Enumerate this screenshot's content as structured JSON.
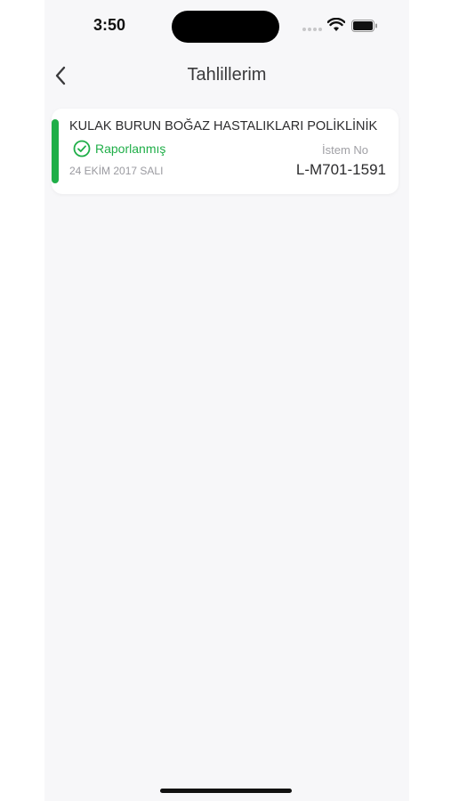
{
  "status_bar": {
    "time": "3:50",
    "icons": [
      "signal-dots-icon",
      "wifi-icon",
      "battery-icon"
    ]
  },
  "nav": {
    "title": "Tahlillerim",
    "back_icon": "chevron-left-icon"
  },
  "records": [
    {
      "clinic": "KULAK BURUN BOĞAZ HASTALIKLARI POLİKLİNİK",
      "status": "Raporlanmış",
      "status_icon": "check-circle-icon",
      "date": "24 EKİM 2017 SALI",
      "istem_label": "İstem No",
      "istem_no": "L-M701-1591"
    }
  ],
  "colors": {
    "accent_green": "#1fae48",
    "background": "#f7f7f9",
    "card": "#ffffff",
    "text_primary": "#2c2c2e",
    "text_secondary": "#9a9aa0"
  }
}
